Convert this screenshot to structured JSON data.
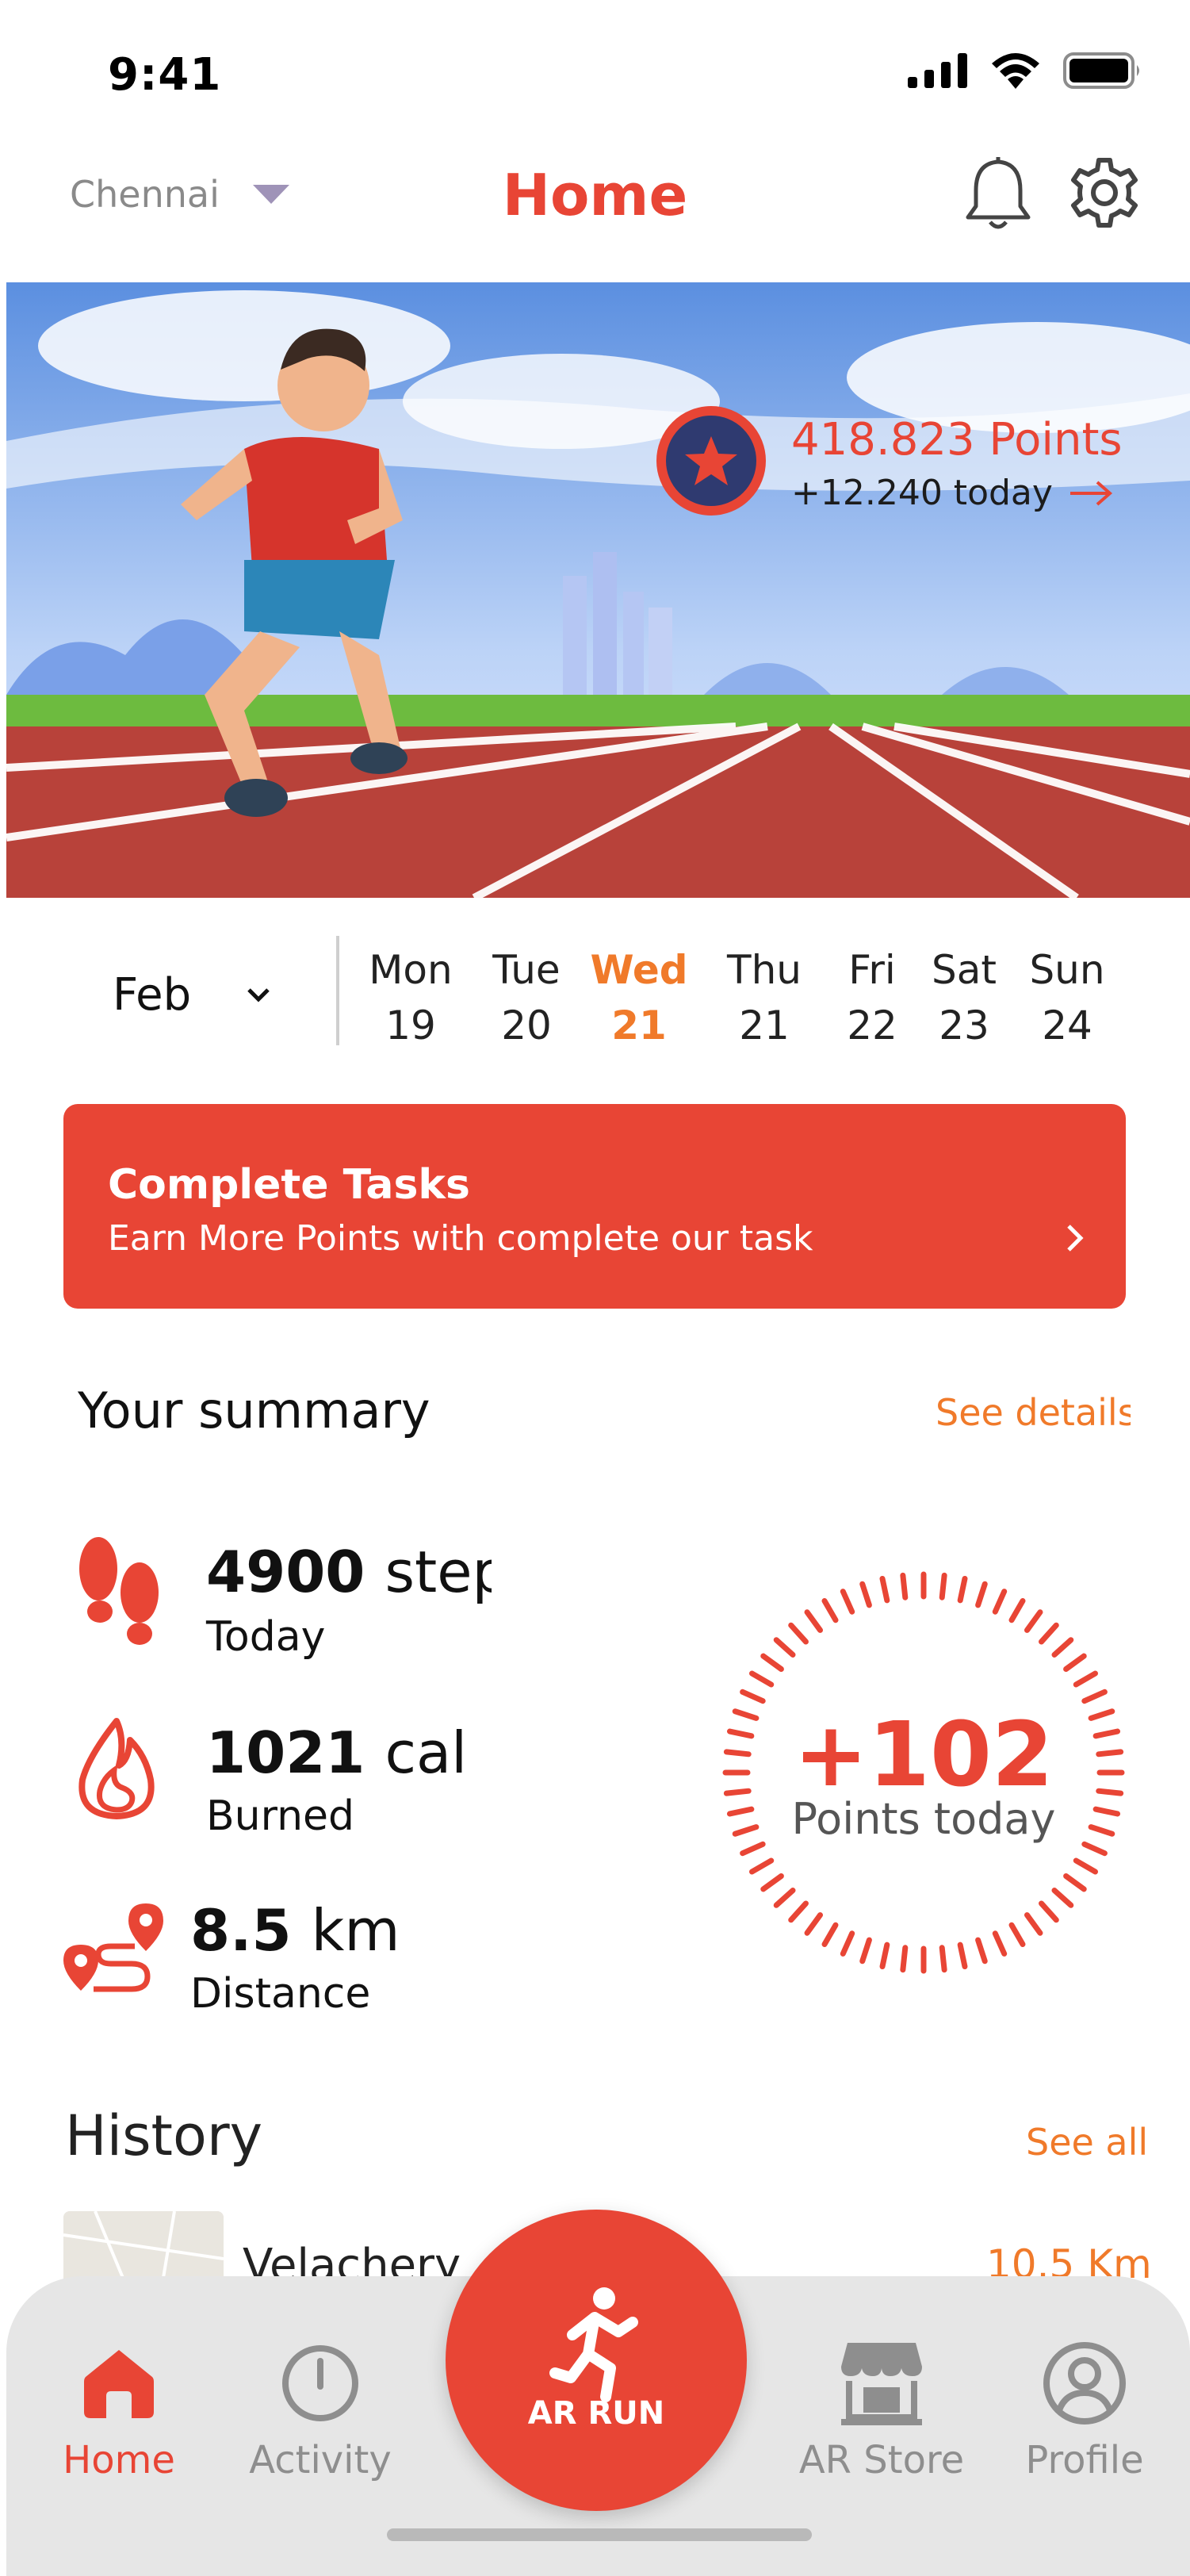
{
  "status_bar": {
    "time": "9:41"
  },
  "header": {
    "location": "Chennai",
    "title": "Home"
  },
  "hero": {
    "points_value": "418.823 Points",
    "points_today": "+12.240 today"
  },
  "calendar": {
    "month": "Feb",
    "days": [
      {
        "name": "Mon",
        "date": "19",
        "active": false
      },
      {
        "name": "Tue",
        "date": "20",
        "active": false
      },
      {
        "name": "Wed",
        "date": "21",
        "active": true
      },
      {
        "name": "Thu",
        "date": "21",
        "active": false
      },
      {
        "name": "Fri",
        "date": "22",
        "active": false
      },
      {
        "name": "Sat",
        "date": "23",
        "active": false
      },
      {
        "name": "Sun",
        "date": "24",
        "active": false
      }
    ]
  },
  "tasks": {
    "title": "Complete Tasks",
    "subtitle": "Earn More Points with complete our task"
  },
  "summary": {
    "title": "Your summary",
    "see_details": "See details",
    "steps": {
      "value": "4900",
      "unit": "step",
      "label": "Today"
    },
    "calories": {
      "value": "1021",
      "unit": "cal",
      "label": "Burned"
    },
    "distance": {
      "value": "8.5",
      "unit": "km",
      "label": "Distance"
    },
    "points_today_value": "+102",
    "points_today_label": "Points today"
  },
  "history": {
    "title": "History",
    "see_all": "See all",
    "items": [
      {
        "place": "Velachery",
        "distance": "10.5 Km"
      }
    ]
  },
  "nav": {
    "home": "Home",
    "activity": "Activity",
    "ar_run": "AR RUN",
    "ar_store": "AR Store",
    "profile": "Profile"
  },
  "colors": {
    "accent": "#E84535",
    "highlight": "#F07A2A",
    "nav_bg": "#E6E6E6"
  }
}
